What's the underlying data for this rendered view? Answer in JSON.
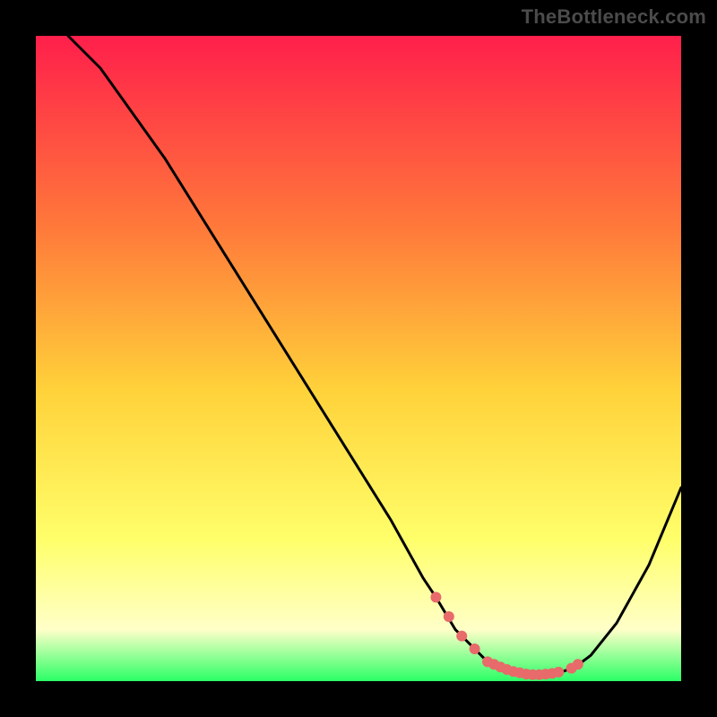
{
  "watermark": "TheBottleneck.com",
  "colors": {
    "gradient_top": "#ff1f4b",
    "gradient_mid1": "#ff7a3a",
    "gradient_mid2": "#ffd23a",
    "gradient_mid3": "#ffff6a",
    "gradient_mid4": "#ffffc8",
    "gradient_bottom": "#2bff66",
    "curve": "#000000",
    "marker": "#e86a6a",
    "background": "#000000"
  },
  "chart_data": {
    "type": "line",
    "title": "",
    "subtitle": "",
    "xlabel": "",
    "ylabel": "",
    "xlim": [
      0,
      100
    ],
    "ylim": [
      0,
      100
    ],
    "grid": false,
    "legend": false,
    "series": [
      {
        "name": "curve",
        "x": [
          5,
          10,
          15,
          20,
          25,
          30,
          35,
          40,
          45,
          50,
          55,
          60,
          62,
          65,
          68,
          70,
          72,
          74,
          76,
          78,
          80,
          82,
          84,
          86,
          90,
          95,
          100
        ],
        "y": [
          100,
          95,
          88,
          81,
          73,
          65,
          57,
          49,
          41,
          33,
          25,
          16,
          13,
          8,
          5,
          3,
          2,
          1.4,
          1,
          1,
          1.2,
          1.6,
          2.5,
          4,
          9,
          18,
          30
        ]
      }
    ],
    "trough_markers": {
      "name": "dots-near-minimum",
      "x": [
        62,
        64,
        66,
        68,
        70,
        71,
        72,
        73,
        74,
        75,
        76,
        77,
        78,
        79,
        80,
        81,
        83,
        84
      ],
      "y": [
        13,
        10,
        7,
        5,
        3,
        2.6,
        2.2,
        1.8,
        1.5,
        1.3,
        1.1,
        1,
        1,
        1.1,
        1.2,
        1.4,
        2,
        2.6
      ]
    }
  }
}
